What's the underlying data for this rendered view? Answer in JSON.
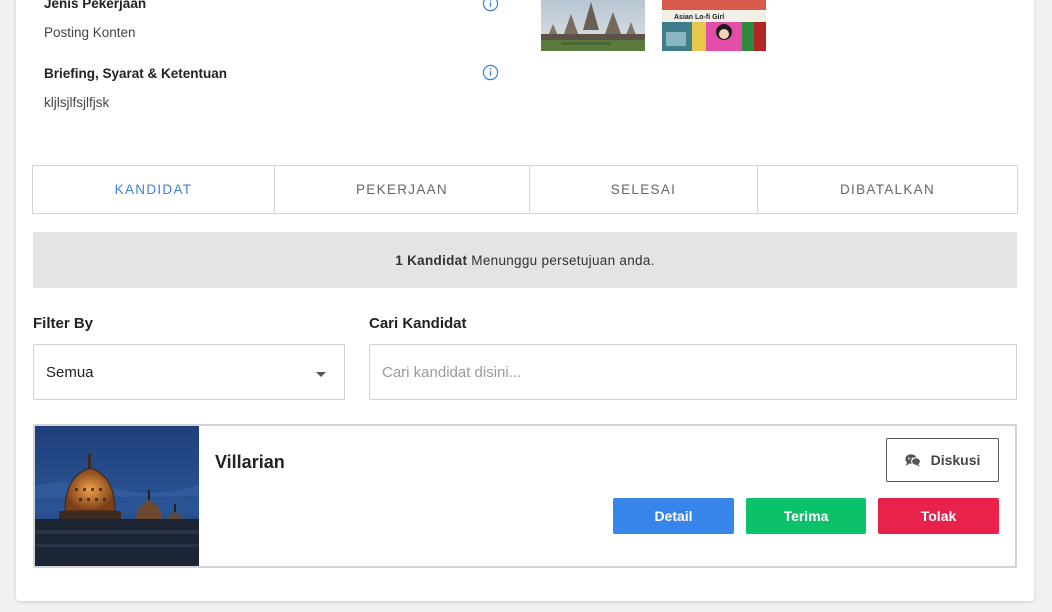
{
  "job": {
    "type_label": "Jenis Pekerjaan",
    "type_value": "Posting Konten",
    "briefing_label": "Briefing, Syarat & Ketentuan",
    "briefing_value": "kljlsjlfsjlfjsk"
  },
  "gallery": {
    "images": [
      "temple-photo",
      "comic-cover-photo"
    ],
    "comic_caption": "Asian Lo-fi Girl"
  },
  "tabs": [
    {
      "label": "KANDIDAT",
      "active": true
    },
    {
      "label": "PEKERJAAN",
      "active": false
    },
    {
      "label": "SELESAI",
      "active": false
    },
    {
      "label": "DIBATALKAN",
      "active": false
    }
  ],
  "notice": {
    "count_text": "1 Kandidat",
    "message": "Menunggu persetujuan anda."
  },
  "filter": {
    "label": "Filter By",
    "selected": "Semua"
  },
  "search": {
    "label": "Cari Kandidat",
    "placeholder": "Cari kandidat disini...",
    "value": ""
  },
  "candidates": [
    {
      "name": "Villarian",
      "photo": "stupa-night-photo",
      "discuss_label": "Diskusi",
      "detail_label": "Detail",
      "accept_label": "Terima",
      "reject_label": "Tolak"
    }
  ],
  "colors": {
    "accent": "#3d84d2",
    "detail": "#3785ea",
    "accept": "#0bc16a",
    "reject": "#e8224b",
    "notice_bg": "#e4e4e4"
  }
}
